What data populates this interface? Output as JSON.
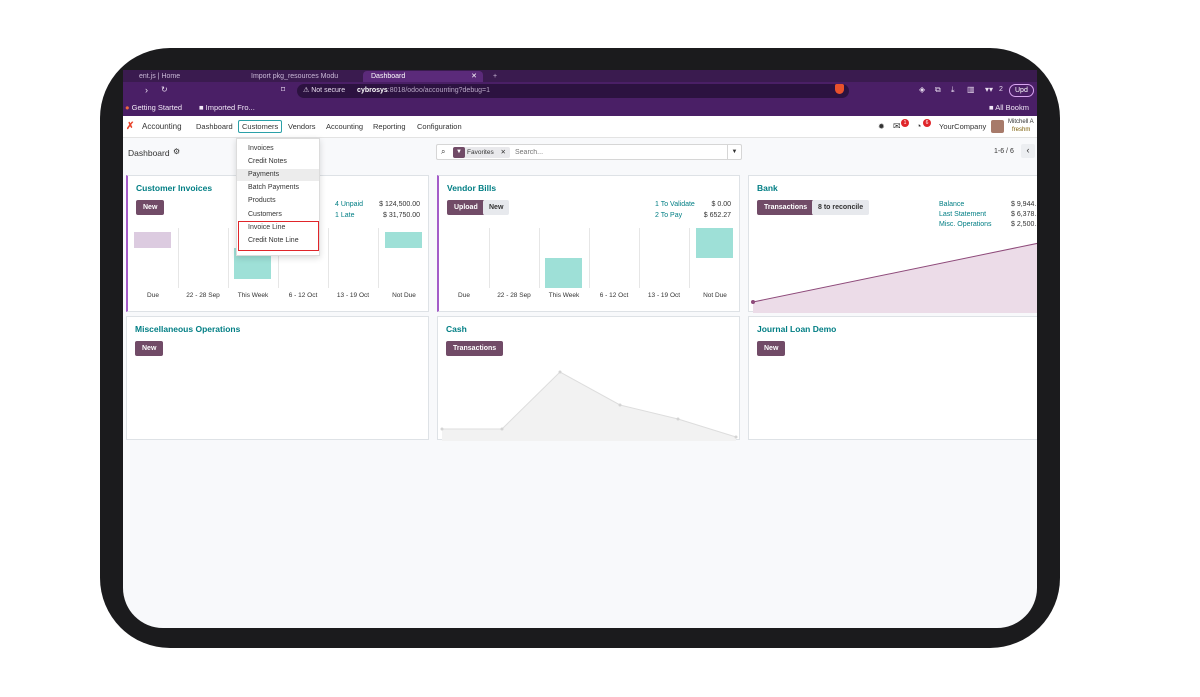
{
  "browser": {
    "tabs": [
      {
        "label": "ent.js | Home",
        "active": false
      },
      {
        "label": "Import pkg_resources Modu",
        "active": false
      },
      {
        "label": "Dashboard",
        "active": true
      }
    ],
    "new_tab": "+",
    "security": "Not secure",
    "url_host": "cybrosys",
    "url_rest": ":8018/odoo/accounting?debug=1",
    "extension_count": "2",
    "update_label": "Upd",
    "bookmarks": [
      {
        "label": "Getting Started"
      },
      {
        "label": "Imported Fro..."
      }
    ],
    "all_bookmarks": "All Bookm"
  },
  "navbar": {
    "app_name": "Accounting",
    "menus": [
      "Dashboard",
      "Customers",
      "Vendors",
      "Accounting",
      "Reporting",
      "Configuration"
    ],
    "selected": "Customers",
    "chat_badge": "1",
    "activity_badge": "6",
    "company": "YourCompany",
    "user_name": "Mitchell A",
    "user_db": "freshm"
  },
  "control_panel": {
    "breadcrumb": "Dashboard",
    "facet": "Favorites",
    "search_placeholder": "Search...",
    "pager": "1-6 / 6"
  },
  "customers_menu": {
    "items": [
      "Invoices",
      "Credit Notes",
      "Payments",
      "Batch Payments",
      "Products",
      "Customers",
      "Invoice Line",
      "Credit Note Line"
    ],
    "highlighted": "Payments",
    "outlined": [
      "Invoice Line",
      "Credit Note Line"
    ]
  },
  "cards": {
    "customer_invoices": {
      "title": "Customer Invoices",
      "new_label": "New",
      "stats": [
        {
          "label": "4 Unpaid",
          "amount": "$ 124,500.00"
        },
        {
          "label": "1 Late",
          "amount": "$ 31,750.00"
        }
      ],
      "x_labels": [
        "Due",
        "22 - 28 Sep",
        "This Week",
        "6 - 12 Oct",
        "13 - 19 Oct",
        "Not Due"
      ]
    },
    "vendor_bills": {
      "title": "Vendor Bills",
      "upload_label": "Upload",
      "new_label": "New",
      "stats": [
        {
          "label": "1 To Validate",
          "amount": "$ 0.00"
        },
        {
          "label": "2 To Pay",
          "amount": "$ 652.27"
        }
      ],
      "x_labels": [
        "Due",
        "22 - 28 Sep",
        "This Week",
        "6 - 12 Oct",
        "13 - 19 Oct",
        "Not Due"
      ]
    },
    "bank": {
      "title": "Bank",
      "transactions_label": "Transactions",
      "reconcile_label": "8 to reconcile",
      "stats": [
        {
          "label": "Balance",
          "amount": "$ 9,944."
        },
        {
          "label": "Last Statement",
          "amount": "$ 6,378."
        },
        {
          "label": "Misc. Operations",
          "amount": "$ 2,500."
        }
      ]
    },
    "misc_operations": {
      "title": "Miscellaneous Operations",
      "new_label": "New"
    },
    "cash": {
      "title": "Cash",
      "transactions_label": "Transactions"
    },
    "journal_loan": {
      "title": "Journal Loan Demo",
      "new_label": "New"
    }
  },
  "colors": {
    "brand": "#714b67",
    "teal": "#017e84",
    "bar_teal": "#9ee0d7",
    "bar_purple": "#dccbe0",
    "browser_purple": "#4a1f66",
    "menu_outline": "#e0252a"
  }
}
